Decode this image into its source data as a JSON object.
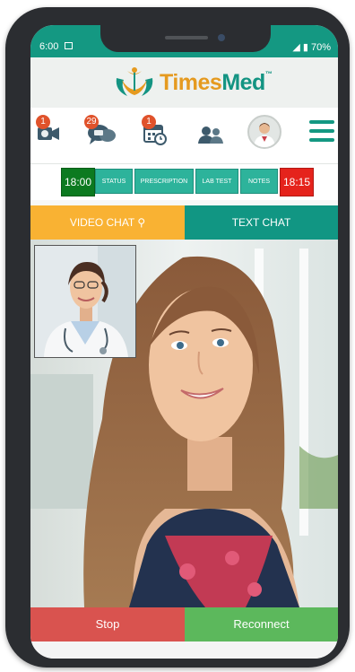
{
  "status_bar": {
    "time": "6:00",
    "battery": "70%"
  },
  "brand": {
    "part1": "Times",
    "part2": "Med",
    "tm": "™"
  },
  "icons": {
    "video_calls": {
      "icon": "video-camera-icon",
      "badge": "1"
    },
    "chat_messages": {
      "icon": "chat-bubbles-icon",
      "badge": "29"
    },
    "appointments": {
      "icon": "calendar-clock-icon",
      "badge": "1"
    },
    "doctors": {
      "icon": "users-icon"
    },
    "profile": {
      "icon": "doctor-avatar-icon"
    },
    "menu": {
      "icon": "hamburger-menu-icon"
    }
  },
  "action_bar": {
    "start_time": "18:00",
    "status": "STATUS",
    "prescription": "PRESCRIPTION",
    "lab_test": "LAB TEST",
    "notes": "NOTES",
    "end_time": "18:15"
  },
  "tabs": {
    "video_chat": "VIDEO CHAT",
    "text_chat": "TEXT CHAT"
  },
  "controls": {
    "stop": "Stop",
    "reconnect": "Reconnect"
  },
  "colors": {
    "teal": "#149882",
    "orange": "#f9b233",
    "stop_red": "#d9534f",
    "reconnect_green": "#5cb85c",
    "start_time_green": "#0c7a20",
    "end_time_red": "#e5231c"
  }
}
